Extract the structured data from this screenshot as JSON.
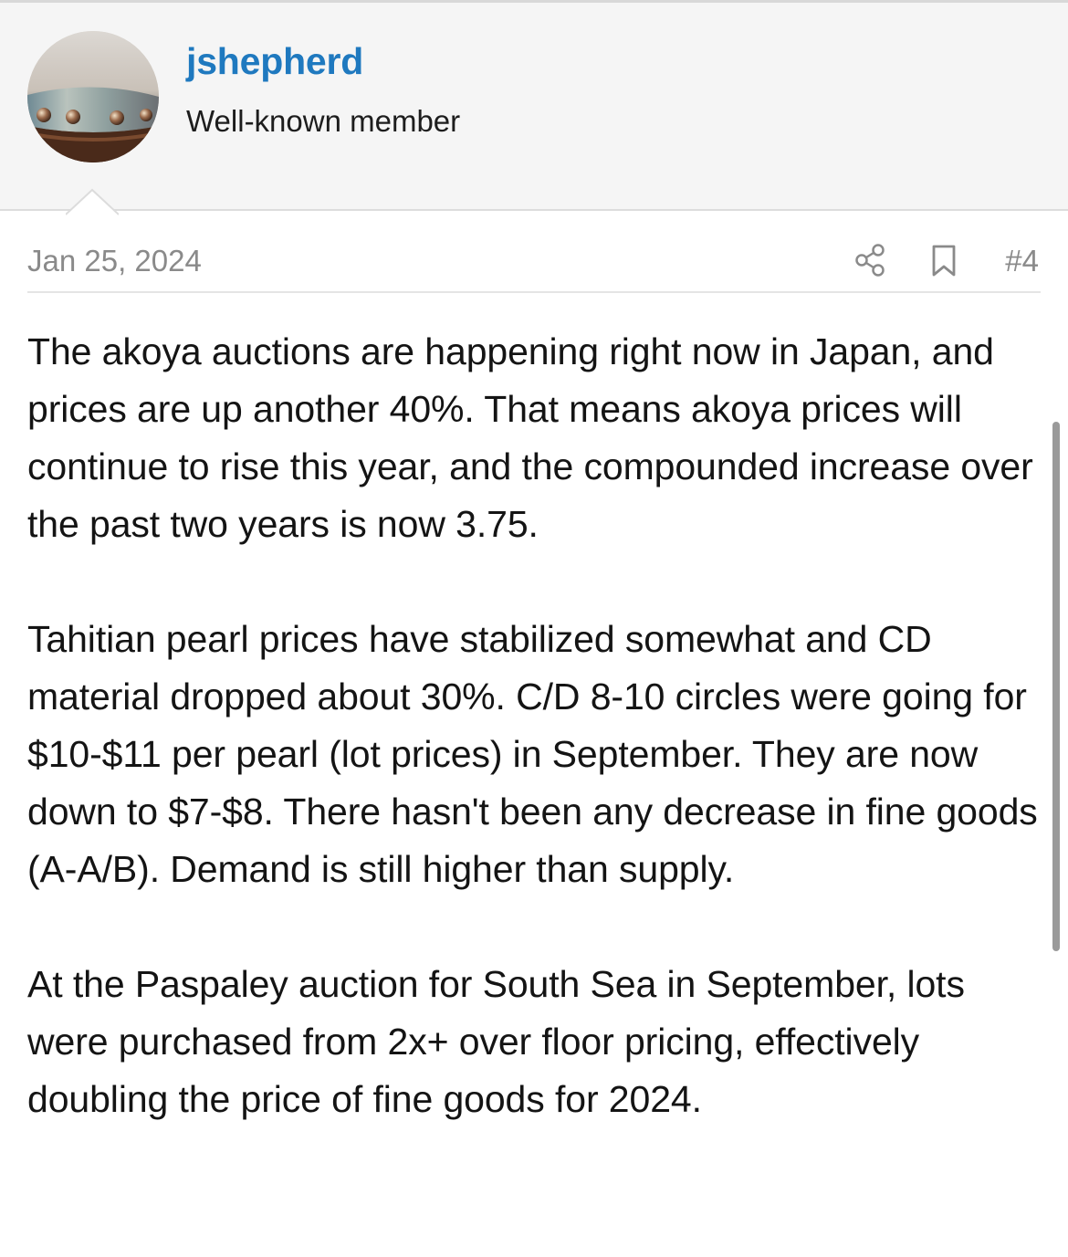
{
  "user": {
    "username": "jshepherd",
    "title": "Well-known member",
    "avatar_icon": "pearl-shell-avatar"
  },
  "post": {
    "date": "Jan 25, 2024",
    "number": "#4",
    "share_icon": "share-icon",
    "bookmark_icon": "bookmark-icon",
    "paragraphs": [
      "The akoya auctions are happening right now in Japan, and prices are up another 40%. That means akoya prices will continue to rise this year, and the compounded increase over the past two years is now 3.75.",
      "Tahitian pearl prices have stabilized somewhat and CD material dropped about 30%. C/D 8-10 circles were going for $10-$11 per pearl (lot prices) in September. They are now down to $7-$8. There hasn't been any decrease in fine goods (A-A/B). Demand is still higher than supply.",
      "At the Paspaley auction for South Sea in September, lots were purchased from 2x+ over floor pricing, effectively doubling the price of fine goods for 2024."
    ]
  },
  "colors": {
    "username": "#1f79bf",
    "header_bg": "#f5f5f5",
    "meta_text": "#8a8a8a",
    "body_text": "#141414"
  }
}
